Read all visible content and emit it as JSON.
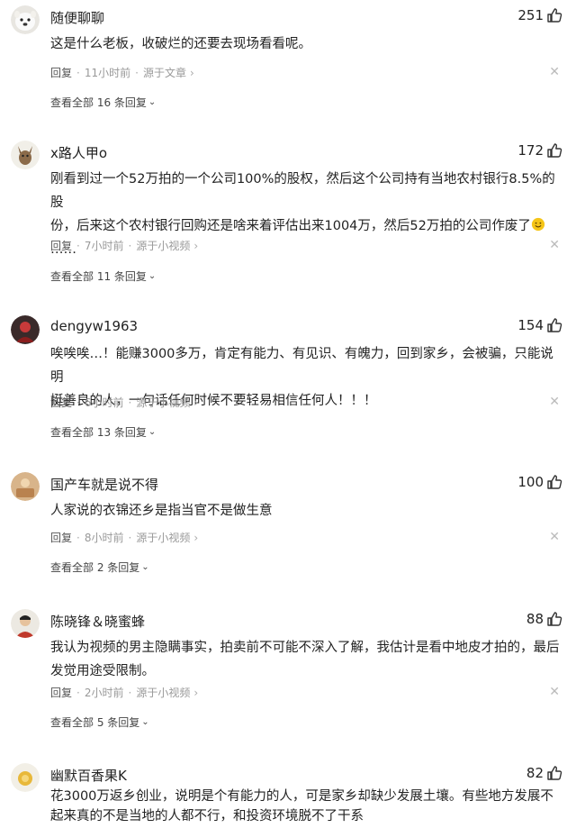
{
  "comments": [
    {
      "name": "随便聊聊",
      "likes": "251",
      "lines": [
        "这是什么老板，收破烂的还要去现场看看呢。"
      ],
      "reply": "回复",
      "time": "11小时前",
      "source": "源于文章",
      "view_all": "查看全部 16 条回复"
    },
    {
      "name": "x路人甲o",
      "likes": "172",
      "lines": [
        "刚看到过一个52万拍的一个公司100%的股权，然后这个公司持有当地农村银行8.5%的股",
        "份，后来这个农村银行回购还是啥来着评估出来1004万，然后52万拍的公司作废了",
        "……"
      ],
      "reply": "回复",
      "time": "7小时前",
      "source": "源于小视频",
      "view_all": "查看全部 11 条回复"
    },
    {
      "name": "dengyw1963",
      "likes": "154",
      "lines": [
        "唉唉唉…！能赚3000多万，肯定有能力、有见识、有魄力，回到家乡，会被骗，只能说明",
        "挺善良的人，一句话任何时候不要轻易相信任何人！！！"
      ],
      "reply": "回复",
      "time": "6小时前",
      "source": "源于小视频",
      "view_all": "查看全部 13 条回复"
    },
    {
      "name": "国产车就是说不得",
      "likes": "100",
      "lines": [
        "人家说的衣锦还乡是指当官不是做生意"
      ],
      "reply": "回复",
      "time": "8小时前",
      "source": "源于小视频",
      "view_all": "查看全部 2 条回复"
    },
    {
      "name": "陈晓锋＆晓蜜蜂",
      "likes": "88",
      "lines": [
        "我认为视频的男主隐瞒事实，拍卖前不可能不深入了解，我估计是看中地皮才拍的，最后",
        "发觉用途受限制。"
      ],
      "reply": "回复",
      "time": "2小时前",
      "source": "源于小视频",
      "view_all": "查看全部 5 条回复"
    },
    {
      "name": "幽默百香果K",
      "likes": "82",
      "lines": [
        "花3000万返乡创业，说明是个有能力的人，可是家乡却缺少发展土壤。有些地方发展不",
        "起来真的不是当地的人都不行，和投资环境脱不了干系"
      ]
    }
  ],
  "icons": {
    "like": "thumbs-up-icon",
    "close": "close-icon",
    "chevron": "chevron-right-icon",
    "expand": "chevron-down-icon"
  },
  "colors": {
    "text": "#222222",
    "meta": "#999999",
    "emoji": "#f5c518"
  }
}
